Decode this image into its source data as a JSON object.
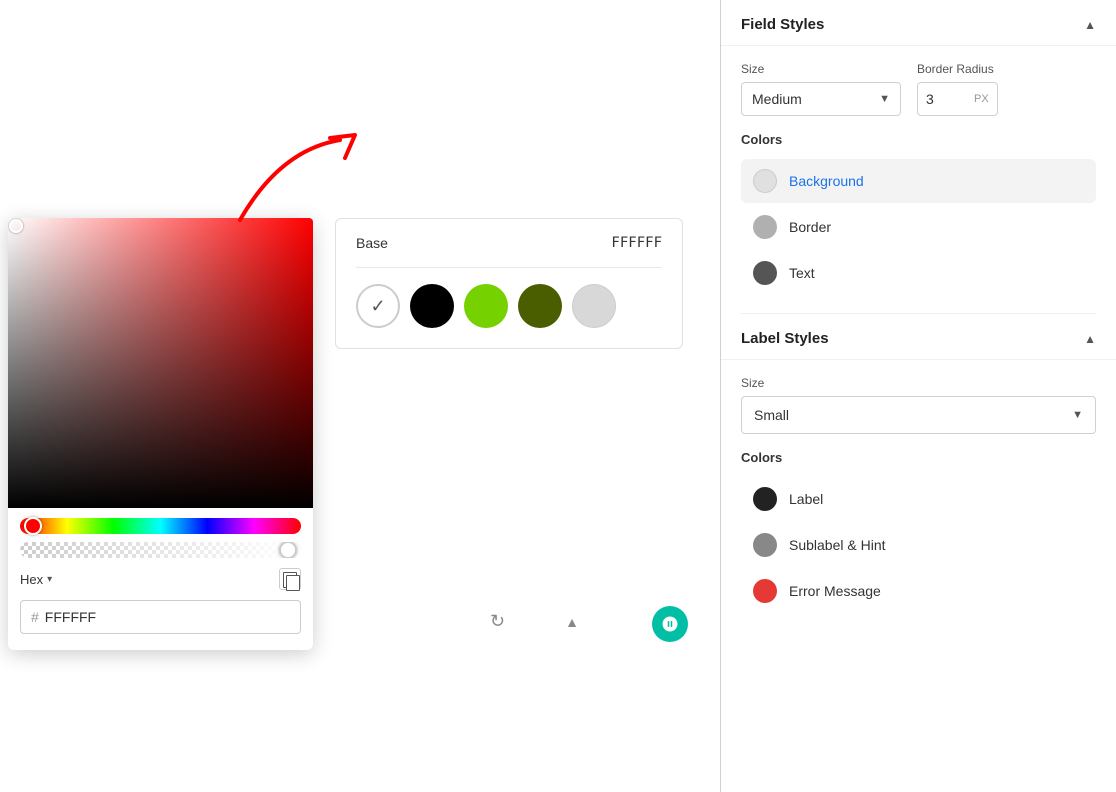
{
  "colorPicker": {
    "hexValue": "FFFFFF",
    "hexLabel": "Hex",
    "hashSymbol": "#"
  },
  "presetsCard": {
    "baseLabel": "Base",
    "hexDisplay": "FFFFFF",
    "swatches": [
      {
        "id": "check",
        "type": "check"
      },
      {
        "id": "black",
        "color": "#000000"
      },
      {
        "id": "lime",
        "color": "#76d100"
      },
      {
        "id": "darkgreen",
        "color": "#4a5e00"
      },
      {
        "id": "lightgray",
        "color": "#d8d8d8"
      }
    ]
  },
  "rightPanel": {
    "fieldStyles": {
      "title": "Field Styles",
      "sizeLabel": "Size",
      "sizeValue": "Medium",
      "borderRadiusLabel": "Border Radius",
      "borderRadiusValue": "3",
      "borderRadiusUnit": "PX",
      "colorsLabel": "Colors",
      "colorItems": [
        {
          "id": "background",
          "label": "Background",
          "color": "#e0e0e0",
          "active": true
        },
        {
          "id": "border",
          "label": "Border",
          "color": "#b0b0b0",
          "active": false
        },
        {
          "id": "text",
          "label": "Text",
          "color": "#555555",
          "active": false
        }
      ]
    },
    "labelStyles": {
      "title": "Label Styles",
      "sizeLabel": "Size",
      "sizeValue": "Small",
      "colorsLabel": "Colors",
      "colorItems": [
        {
          "id": "label",
          "label": "Label",
          "color": "#222222",
          "active": false
        },
        {
          "id": "sublabel",
          "label": "Sublabel & Hint",
          "color": "#888888",
          "active": false
        },
        {
          "id": "error",
          "label": "Error Message",
          "color": "#e53935",
          "active": false
        }
      ]
    }
  }
}
